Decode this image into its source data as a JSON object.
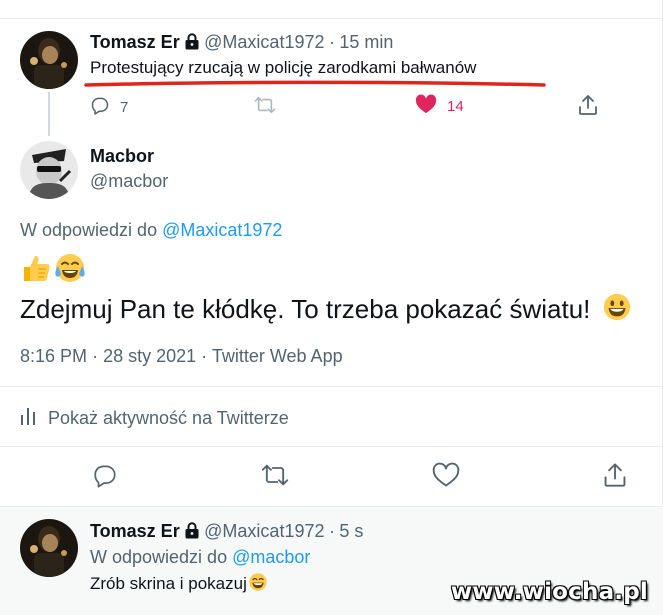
{
  "parent_tweet": {
    "name": "Tomasz Er",
    "handle": "@Maxicat1972",
    "separator": "·",
    "time": "15 min",
    "text": "Protestujący rzucają w policję zarodkami bałwanów",
    "reply_count": "7",
    "like_count": "14",
    "icons": [
      "reply-icon",
      "retweet-icon",
      "heart-filled-icon",
      "share-icon",
      "lock-icon"
    ],
    "like_color": "#e0245e",
    "underline_color": "#e0251b"
  },
  "focal_tweet": {
    "name": "Macbor",
    "handle": "@macbor",
    "reply_prefix": "W odpowiedzi do",
    "reply_handle": "@Maxicat1972",
    "emojis": [
      "👍",
      "😂"
    ],
    "text": "Zdejmuj Pan te kłódkę. To trzeba pokazać światu!",
    "text_emoji": "😀",
    "time": "8:16 PM",
    "date": "28 sty 2021",
    "source": "Twitter Web App",
    "separator": "·",
    "activity_label": "Pokaż aktywność na Twitterze",
    "icons": [
      "chart-bars-icon",
      "reply-icon",
      "retweet-icon",
      "heart-icon",
      "share-icon"
    ]
  },
  "reply_tweet": {
    "name": "Tomasz Er",
    "handle": "@Maxicat1972",
    "separator": "·",
    "time": "5 s",
    "reply_prefix": "W odpowiedzi do",
    "reply_handle": "@macbor",
    "text": "Zrób skrina i pokazuj",
    "text_emoji": "😄"
  },
  "watermark": "www.wiocha.pl",
  "colors": {
    "link": "#1d9bf0",
    "muted": "#536471",
    "text": "#0f1419",
    "divider": "#e6ecf0"
  }
}
